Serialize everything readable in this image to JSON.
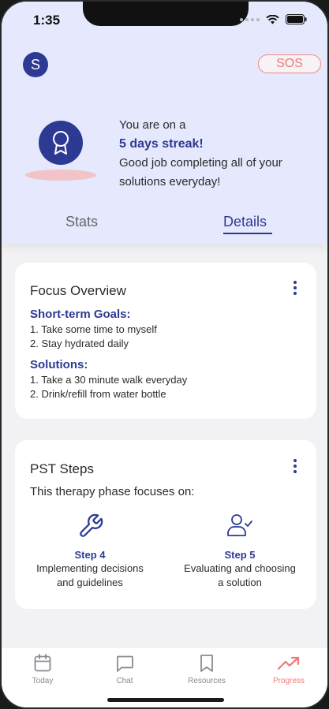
{
  "status": {
    "time": "1:35"
  },
  "header": {
    "avatar_initial": "S",
    "sos_label": "SOS",
    "streak_line1": "You are on a",
    "streak_line2": "5 days streak!",
    "streak_line3": "Good job completing all of your",
    "streak_line4": "solutions everyday!"
  },
  "tabs": {
    "stats": "Stats",
    "details": "Details"
  },
  "focus": {
    "title": "Focus Overview",
    "goals_title": "Short-term Goals:",
    "goals": [
      "1. Take some time to myself",
      "2. Stay hydrated daily"
    ],
    "solutions_title": "Solutions:",
    "solutions": [
      "1. Take a 30 minute walk everyday",
      "2. Drink/refill from water bottle"
    ]
  },
  "pst": {
    "title": "PST Steps",
    "phase_text": "This therapy phase focuses on:",
    "steps": [
      {
        "label": "Step 4",
        "desc1": "Implementing decisions",
        "desc2": "and guidelines",
        "icon": "wrench-icon"
      },
      {
        "label": "Step 5",
        "desc1": "Evaluating and choosing",
        "desc2": "a solution",
        "icon": "user-check-icon"
      }
    ]
  },
  "tabbar": {
    "items": [
      {
        "label": "Today",
        "icon": "calendar-icon"
      },
      {
        "label": "Chat",
        "icon": "chat-icon"
      },
      {
        "label": "Resources",
        "icon": "bookmark-icon"
      },
      {
        "label": "Progress",
        "icon": "trending-up-icon",
        "active": true
      }
    ]
  },
  "colors": {
    "accent": "#2d3a93",
    "sos": "#f07a76",
    "header_bg": "#e6e8fd"
  }
}
